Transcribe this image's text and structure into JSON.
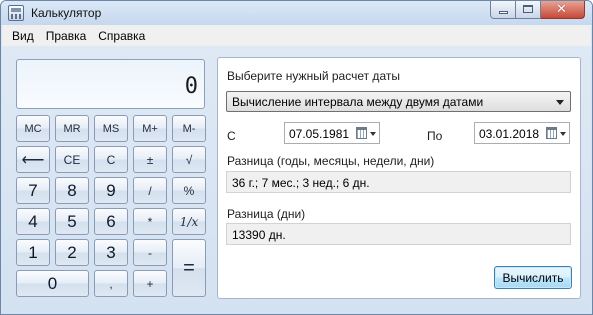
{
  "window": {
    "title": "Калькулятор"
  },
  "caption": {
    "minimize": "–",
    "maximize": "□",
    "close": "✕"
  },
  "menu": {
    "items": [
      "Вид",
      "Правка",
      "Справка"
    ]
  },
  "display": {
    "value": "0"
  },
  "keypad": {
    "row1": [
      "MC",
      "MR",
      "MS",
      "M+",
      "M-"
    ],
    "row2": [
      "⟵",
      "CE",
      "C",
      "±",
      "√"
    ],
    "row3": [
      "7",
      "8",
      "9",
      "/",
      "%"
    ],
    "row4": [
      "4",
      "5",
      "6",
      "*",
      "1/x"
    ],
    "row5": [
      "1",
      "2",
      "3",
      "-"
    ],
    "row6": [
      "0",
      ",",
      "+"
    ],
    "equals": "="
  },
  "date_panel": {
    "heading": "Выберите нужный расчет даты",
    "mode_selected": "Вычисление интервала между двумя датами",
    "from_label": "С",
    "from_value": "07.05.1981",
    "to_label": "По",
    "to_value": "03.01.2018",
    "diff_label": "Разница (годы, месяцы, недели, дни)",
    "diff_value": "36 г.; 7 мес.; 3 нед.; 6 дн.",
    "days_label": "Разница (дни)",
    "days_value": "13390 дн.",
    "calculate_button": "Вычислить"
  }
}
